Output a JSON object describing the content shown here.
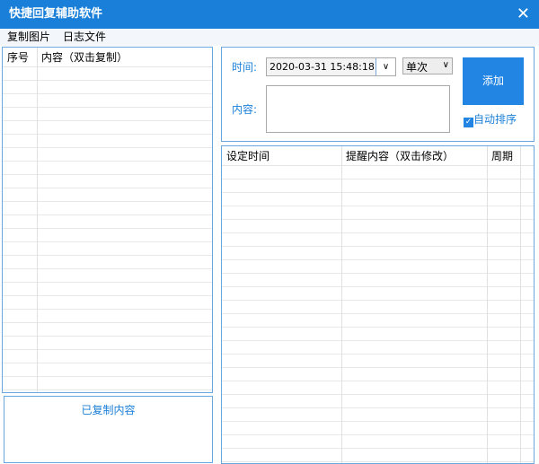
{
  "window": {
    "title": "快捷回复辅助软件",
    "close": "✕"
  },
  "menu": [
    "复制图片",
    "日志文件"
  ],
  "left_table": {
    "headers": [
      "序号",
      "内容（双击复制）"
    ]
  },
  "copied_box": {
    "label": "已复制内容"
  },
  "form": {
    "time_label": "时间:",
    "time_value": "2020-03-31 15:48:18",
    "period_value": "单次",
    "content_label": "内容:",
    "add_button": "添加",
    "auto_sort": "自动排序",
    "auto_sort_checked": true
  },
  "right_table": {
    "headers": [
      "设定时间",
      "提醒内容（双击修改）",
      "周期"
    ]
  }
}
